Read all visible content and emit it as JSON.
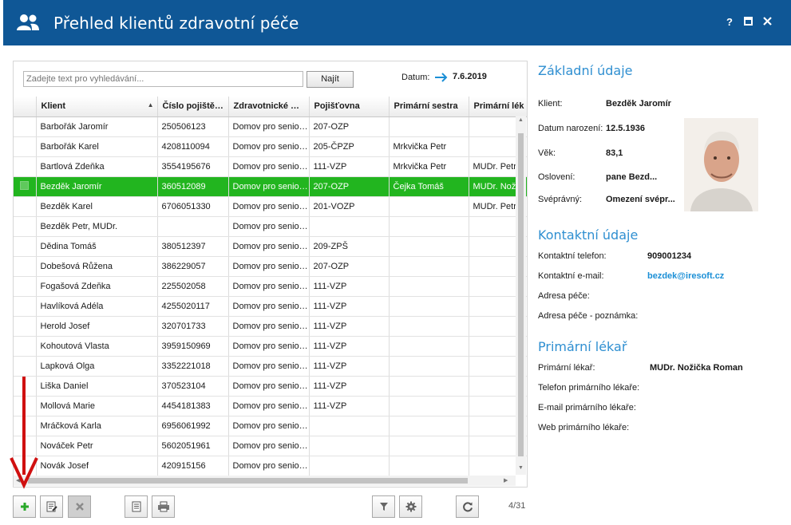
{
  "window": {
    "title": "Přehled klientů zdravotní péče",
    "controls": [
      "?",
      "maximize",
      "close"
    ]
  },
  "search": {
    "placeholder": "Zadejte text pro vyhledávání...",
    "button_label": "Najít",
    "date_label": "Datum:",
    "date_value": "7.6.2019"
  },
  "table": {
    "columns": [
      "Klient",
      "Číslo pojiště…",
      "Zdravotnické …",
      "Pojišťovna",
      "Primární sestra",
      "Primární lék"
    ],
    "selected_index": 3,
    "rows": [
      [
        "Barbořák Jaromír",
        "250506123",
        "Domov pro senio…",
        "207-OZP",
        "",
        ""
      ],
      [
        "Barbořák Karel",
        "4208110094",
        "Domov pro senio…",
        "205-ČPZP",
        "Mrkvička Petr",
        ""
      ],
      [
        "Bartlová Zdeňka",
        "3554195676",
        "Domov pro senio…",
        "111-VZP",
        "Mrkvička Petr",
        "MUDr. Petr"
      ],
      [
        "Bezděk Jaromír",
        "360512089",
        "Domov pro senio…",
        "207-OZP",
        "Čejka Tomáš",
        "MUDr. Noži"
      ],
      [
        "Bezděk Karel",
        "6706051330",
        "Domov pro senio…",
        "201-VOZP",
        "",
        "MUDr. Petr"
      ],
      [
        "Bezděk Petr, MUDr.",
        "",
        "Domov pro senio…",
        "",
        "",
        ""
      ],
      [
        "Dědina Tomáš",
        "380512397",
        "Domov pro senio…",
        "209-ZPŠ",
        "",
        ""
      ],
      [
        "Dobešová Růžena",
        "386229057",
        "Domov pro senio…",
        "207-OZP",
        "",
        ""
      ],
      [
        "Fogašová Zdeňka",
        "225502058",
        "Domov pro senio…",
        "111-VZP",
        "",
        ""
      ],
      [
        "Havlíková Adéla",
        "4255020117",
        "Domov pro senio…",
        "111-VZP",
        "",
        ""
      ],
      [
        "Herold Josef",
        "320701733",
        "Domov pro senio…",
        "111-VZP",
        "",
        ""
      ],
      [
        "Kohoutová Vlasta",
        "3959150969",
        "Domov pro senio…",
        "111-VZP",
        "",
        ""
      ],
      [
        "Lapková Olga",
        "3352221018",
        "Domov pro senio…",
        "111-VZP",
        "",
        ""
      ],
      [
        "Liška Daniel",
        "370523104",
        "Domov pro senio…",
        "111-VZP",
        "",
        ""
      ],
      [
        "Mollová Marie",
        "4454181383",
        "Domov pro senio…",
        "111-VZP",
        "",
        ""
      ],
      [
        "Mráčková Karla",
        "6956061992",
        "Domov pro senio…",
        "",
        "",
        ""
      ],
      [
        "Nováček Petr",
        "5602051961",
        "Domov pro senio…",
        "",
        "",
        ""
      ],
      [
        "Novák Josef",
        "420915156",
        "Domov pro senio…",
        "",
        "",
        ""
      ]
    ]
  },
  "pager": "4/31",
  "details": {
    "basic": {
      "title": "Základní údaje",
      "fields": [
        {
          "label": "Klient:",
          "value": "Bezděk Jaromír"
        },
        {
          "label": "Datum narození:",
          "value": "12.5.1936"
        },
        {
          "label": "Věk:",
          "value": "83,1"
        },
        {
          "label": "Oslovení:",
          "value": "pane Bezd..."
        },
        {
          "label": "Svéprávný:",
          "value": "Omezení svépr..."
        }
      ]
    },
    "contact": {
      "title": "Kontaktní údaje",
      "fields": [
        {
          "label": "Kontaktní telefon:",
          "value": "909001234"
        },
        {
          "label": "Kontaktní e-mail:",
          "value": "bezdek@iresoft.cz"
        },
        {
          "label": "Adresa péče:",
          "value": ""
        },
        {
          "label": "Adresa péče - poznámka:",
          "value": ""
        }
      ]
    },
    "doctor": {
      "title": "Primární lékař",
      "fields": [
        {
          "label": "Primární lékař:",
          "value": "MUDr. Nožička Roman"
        },
        {
          "label": "Telefon primárního lékaře:",
          "value": ""
        },
        {
          "label": "E-mail primárního lékaře:",
          "value": ""
        },
        {
          "label": "Web primárního lékaře:",
          "value": ""
        }
      ]
    }
  },
  "colors": {
    "titlebar": "#0f5796",
    "selection": "#22b51f",
    "section_title": "#2f8fd1",
    "link": "#1b8fd6",
    "annotation_arrow": "#d01010"
  },
  "icons": [
    "users-icon",
    "help-icon",
    "maximize-icon",
    "close-icon",
    "arrow-right-icon",
    "add-icon",
    "edit-icon",
    "delete-icon",
    "document-icon",
    "print-icon",
    "filter-icon",
    "settings-icon",
    "refresh-icon"
  ]
}
